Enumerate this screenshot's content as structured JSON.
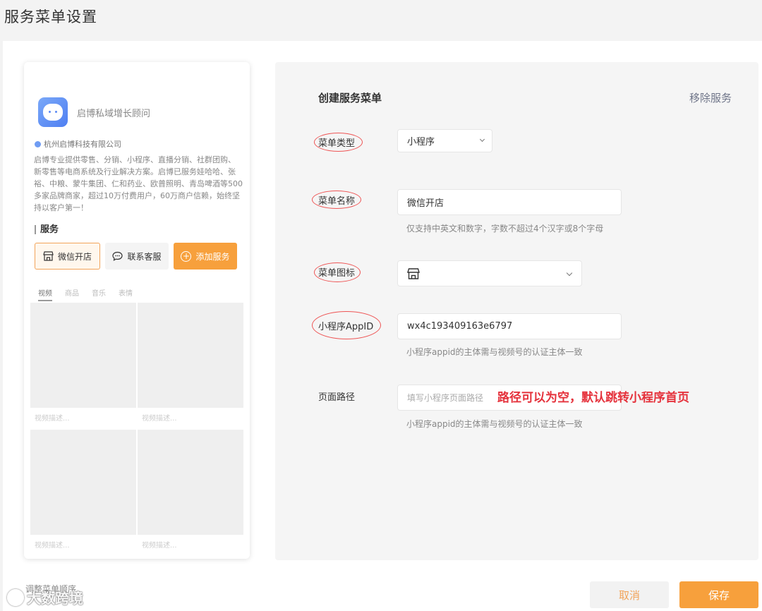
{
  "page": {
    "title": "服务菜单设置"
  },
  "preview": {
    "account_name": "启博私域增长顾问",
    "company": "杭州启博科技有限公司",
    "description": "启博专业提供零售、分销、小程序、直播分销、社群团购、新零售等电商系统及行业解决方案。启博已服务娃哈哈、张裕、中粮、蒙牛集团、仁和药业、欧普照明、青岛啤酒等500多家品牌商家，超过10万付费用户，60万商户信赖，始终坚持以客户第一！",
    "services_heading": "服务",
    "service_buttons": [
      "微信开店",
      "联系客服",
      "添加服务"
    ],
    "tabs": [
      "视频",
      "商品",
      "音乐",
      "表情"
    ],
    "video_caption": "视频描述..."
  },
  "form": {
    "title": "创建服务菜单",
    "remove_label": "移除服务",
    "menu_type": {
      "label": "菜单类型",
      "value": "小程序"
    },
    "menu_name": {
      "label": "菜单名称",
      "value": "微信开店",
      "hint": "仅支持中英文和数字，字数不超过4个汉字或8个字母"
    },
    "menu_icon": {
      "label": "菜单图标",
      "icon": "store-icon"
    },
    "appid": {
      "label": "小程序AppID",
      "value": "wx4c193409163e6797",
      "hint": "小程序appid的主体需与视频号的认证主体一致"
    },
    "page_path": {
      "label": "页面路径",
      "placeholder": "填写小程序页面路径",
      "hint": "小程序appid的主体需与视频号的认证主体一致"
    },
    "annotation": "路径可以为空，默认跳转小程序首页"
  },
  "footer": {
    "reorder_label": "调整菜单顺序",
    "cancel_label": "取消",
    "save_label": "保存",
    "watermark": "大数跨境"
  },
  "colors": {
    "accent": "#f7a03c",
    "annotation_red": "#e5323c"
  }
}
